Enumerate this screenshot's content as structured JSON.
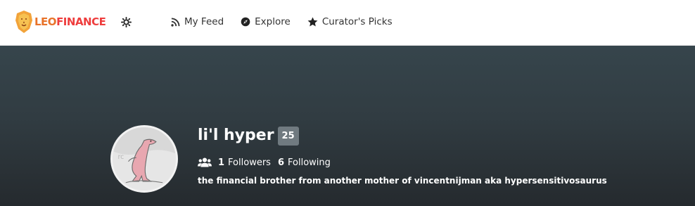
{
  "header": {
    "logo_text_1": "LEO",
    "logo_text_2": "FINANCE",
    "nav": [
      {
        "label": "My Feed",
        "icon": "rss-icon"
      },
      {
        "label": "Explore",
        "icon": "compass-icon"
      },
      {
        "label": "Curator's Picks",
        "icon": "star-icon"
      }
    ]
  },
  "profile": {
    "name": "li'l hyper",
    "reputation": "25",
    "followers_count": "1",
    "followers_label": "Followers",
    "following_count": "6",
    "following_label": "Following",
    "about": "the financial brother from another mother of vincentnijman aka hypersensitivosaurus"
  },
  "colors": {
    "brand_orange": "#e8732a",
    "brand_red": "#ee3d3d",
    "banner_top": "#36454c",
    "banner_bottom": "#252a2e",
    "badge_bg": "#707a80"
  }
}
